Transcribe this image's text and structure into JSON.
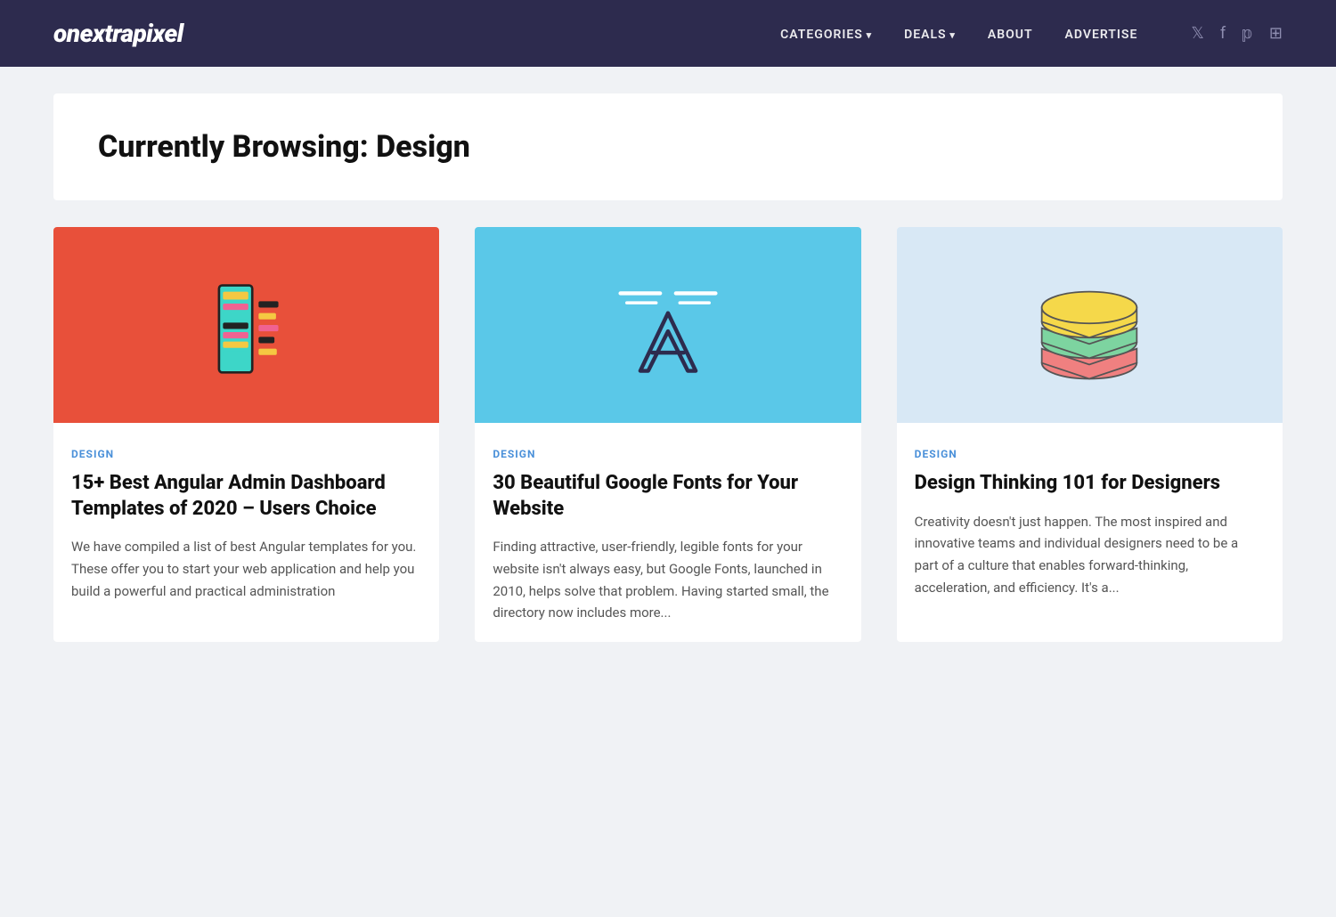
{
  "site": {
    "logo": "onextrapixel"
  },
  "nav": {
    "links": [
      {
        "label": "CATEGORIES",
        "hasArrow": true
      },
      {
        "label": "DEALS",
        "hasArrow": true
      },
      {
        "label": "ABOUT",
        "hasArrow": false
      },
      {
        "label": "ADVERTISE",
        "hasArrow": false
      }
    ],
    "social": [
      "twitter",
      "facebook",
      "pinterest",
      "rss"
    ]
  },
  "hero": {
    "title": "Currently Browsing: Design"
  },
  "cards": [
    {
      "category": "DESIGN",
      "title": "15+ Best Angular Admin Dashboard Templates of 2020 – Users Choice",
      "excerpt": "We have compiled a list of best Angular templates for you. These offer you to start your web application and help you build a powerful and practical administration",
      "image_bg": "red-bg",
      "image_type": "dashboard"
    },
    {
      "category": "DESIGN",
      "title": "30 Beautiful Google Fonts for Your Website",
      "excerpt": "Finding attractive, user-friendly, legible fonts for your website isn't always easy, but Google Fonts, launched in 2010, helps solve that problem. Having started small, the directory now includes more...",
      "image_bg": "blue-bg",
      "image_type": "typography"
    },
    {
      "category": "DESIGN",
      "title": "Design Thinking 101 for Designers",
      "excerpt": "Creativity doesn't just happen. The most inspired and innovative teams and individual designers need to be a part of a culture that enables forward-thinking, acceleration, and efficiency. It's a...",
      "image_bg": "lightblue-bg",
      "image_type": "layers"
    }
  ]
}
